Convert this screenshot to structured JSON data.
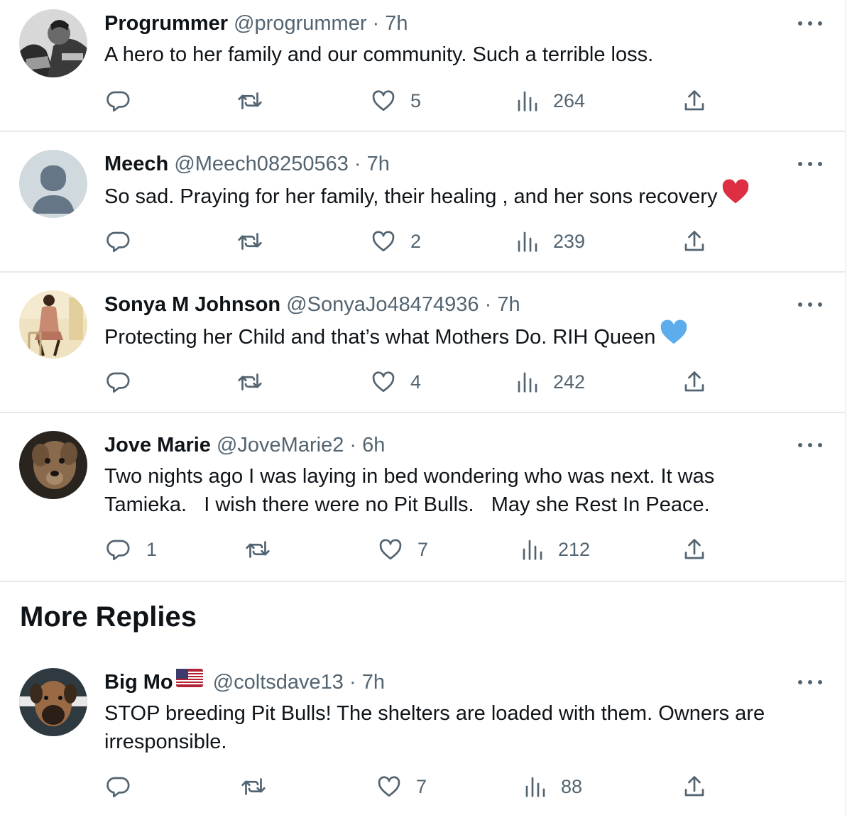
{
  "replies": [
    {
      "name": "Progrummer",
      "handle": "@progrummer",
      "separator": "·",
      "time": "7h",
      "text": "A hero to her family and our community. Such a terrible loss.",
      "reply_count": "",
      "retweet_count": "",
      "like_count": "5",
      "view_count": "264"
    },
    {
      "name": "Meech",
      "handle": "@Meech08250563",
      "separator": "·",
      "time": "7h",
      "text": "So sad. Praying for her family, their healing , and her sons recovery",
      "emoji": "red-heart",
      "reply_count": "",
      "retweet_count": "",
      "like_count": "2",
      "view_count": "239"
    },
    {
      "name": "Sonya M Johnson",
      "handle": "@SonyaJo48474936",
      "separator": "·",
      "time": "7h",
      "text": "Protecting her Child and that’s what Mothers Do. RIH Queen",
      "emoji": "blue-heart",
      "reply_count": "",
      "retweet_count": "",
      "like_count": "4",
      "view_count": "242"
    },
    {
      "name": "Jove Marie",
      "handle": "@JoveMarie2",
      "separator": "·",
      "time": "6h",
      "text": "Two nights ago I was laying in bed wondering who was next. It was\nTamieka.   I wish there were no Pit Bulls.   May she Rest In Peace.",
      "reply_count": "1",
      "retweet_count": "",
      "like_count": "7",
      "view_count": "212"
    }
  ],
  "more_replies_title": "More Replies",
  "more_replies": [
    {
      "name": "Big Mo",
      "flag": "us-flag",
      "handle": "@coltsdave13",
      "separator": "·",
      "time": "7h",
      "text": "STOP breeding Pit Bulls! The shelters are loaded with them. Owners are\nirresponsible.",
      "reply_count": "",
      "retweet_count": "",
      "like_count": "7",
      "view_count": "88"
    }
  ],
  "icons": {
    "reply": "reply-icon",
    "retweet": "retweet-icon",
    "like": "like-icon",
    "views": "views-icon",
    "share": "share-icon",
    "more": "more-icon"
  },
  "colors": {
    "text": "#0f1419",
    "secondary": "#536471",
    "divider": "#e7e9ea",
    "red_heart": "#dd2e44",
    "blue_heart": "#5dadec"
  }
}
